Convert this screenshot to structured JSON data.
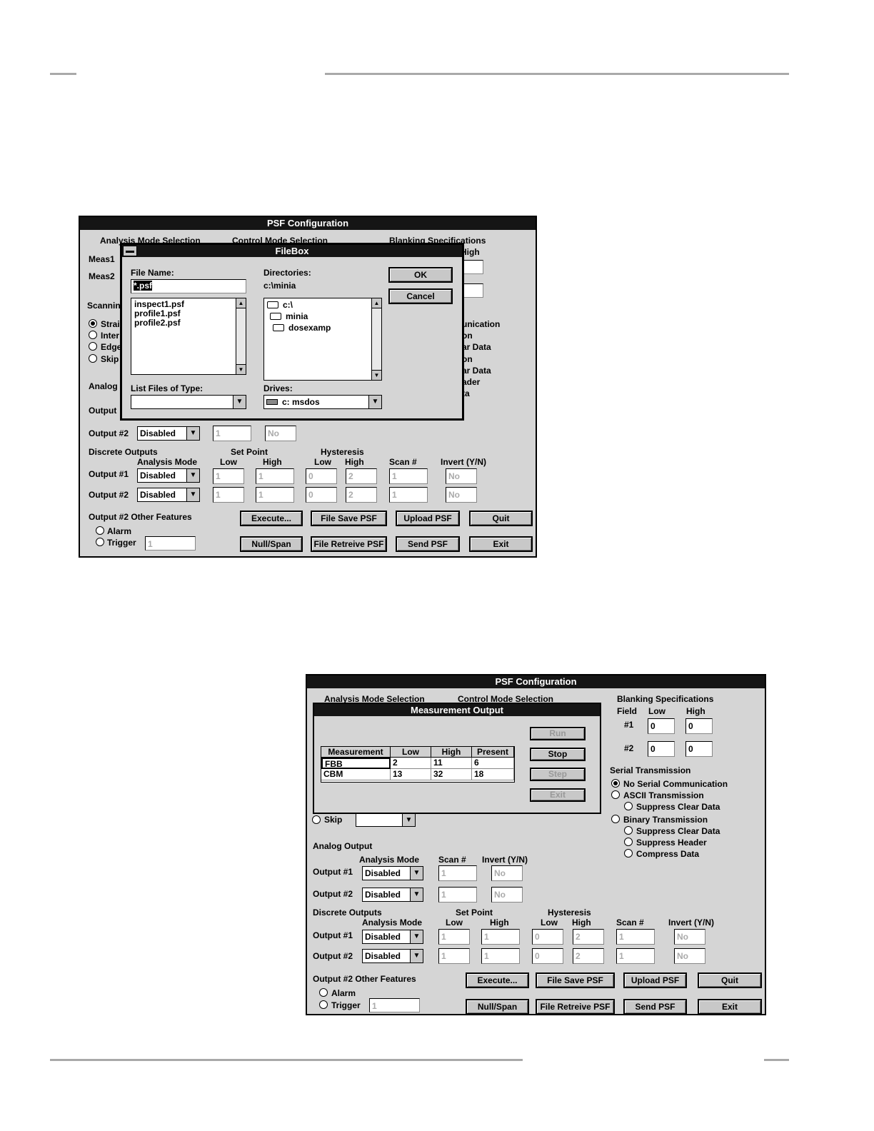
{
  "psf_title": "PSF Configuration",
  "top": {
    "analysis_mode_selection": "Analysis Mode Selection",
    "control_mode_selection": "Control Mode Selection",
    "blanking_specifications": "Blanking Specifications",
    "high_partial": "High",
    "meas1": "Meas1",
    "meas2": "Meas2",
    "scanning_partial": "Scannin",
    "scan_opts": [
      "Strai",
      "Inter",
      "Edge",
      "Skip"
    ],
    "right_fragments": [
      "unication",
      "on",
      "ar Data",
      "on",
      "ar Data",
      "ader",
      "ta"
    ],
    "analog_partial": "Analog",
    "output_partial": "Output",
    "filebox": {
      "title": "FileBox",
      "file_name_label": "File Name:",
      "file_name_value": "*.psf",
      "files": [
        "inspect1.psf",
        "profile1.psf",
        "profile2.psf"
      ],
      "directories_label": "Directories:",
      "current_dir": "c:\\minia",
      "dirs": [
        "c:\\",
        "minia",
        "dosexamp"
      ],
      "ok": "OK",
      "cancel": "Cancel",
      "list_files_label": "List Files of Type:",
      "drives_label": "Drives:",
      "drive_value": "c: msdos"
    },
    "out2_label": "Output #2",
    "out2_mode": "Disabled",
    "out2_scan": "1",
    "out2_invert": "No",
    "discrete": {
      "title": "Discrete Outputs",
      "analysis_mode": "Analysis Mode",
      "set_point": "Set Point",
      "hysteresis": "Hysteresis",
      "low": "Low",
      "high": "High",
      "scan": "Scan #",
      "invert": "Invert (Y/N)",
      "rows": [
        {
          "label": "Output #1",
          "mode": "Disabled",
          "sp_low": "1",
          "sp_high": "1",
          "hy_low": "0",
          "hy_high": "2",
          "scan": "1",
          "invert": "No"
        },
        {
          "label": "Output #2",
          "mode": "Disabled",
          "sp_low": "1",
          "sp_high": "1",
          "hy_low": "0",
          "hy_high": "2",
          "scan": "1",
          "invert": "No"
        }
      ]
    },
    "other_features": "Output #2 Other Features",
    "alarm": "Alarm",
    "trigger": "Trigger",
    "trigger_value": "1",
    "buttons": [
      "Execute...",
      "File Save PSF",
      "Upload PSF",
      "Quit",
      "Null/Span",
      "File Retreive PSF",
      "Send PSF",
      "Exit"
    ]
  },
  "bottom": {
    "analysis_mode_selection": "Analysis Mode Selection",
    "control_mode_selection": "Control Mode Selection",
    "blanking": {
      "title": "Blanking Specifications",
      "field": "Field",
      "low": "Low",
      "high": "High",
      "rows": [
        {
          "label": "#1",
          "low": "0",
          "high": "0"
        },
        {
          "label": "#2",
          "low": "0",
          "high": "0"
        }
      ]
    },
    "serial": {
      "title": "Serial Transmission",
      "options": [
        "No Serial Communication",
        "ASCII Transmission",
        "Suppress Clear Data",
        "Binary Transmission",
        "Suppress Clear Data",
        "Suppress Header",
        "Compress Data"
      ]
    },
    "skip": "Skip",
    "measurement": {
      "title": "Measurement Output",
      "buttons": [
        "Run",
        "Stop",
        "Step",
        "Exit"
      ],
      "columns": [
        "Measurement",
        "Low",
        "High",
        "Present"
      ],
      "rows": [
        [
          "FBB",
          "2",
          "11",
          "6"
        ],
        [
          "CBM",
          "13",
          "32",
          "18"
        ]
      ]
    },
    "analog": {
      "title": "Analog Output",
      "analysis_mode": "Analysis Mode",
      "scan": "Scan #",
      "invert": "Invert (Y/N)",
      "rows": [
        {
          "label": "Output #1",
          "mode": "Disabled",
          "scan": "1",
          "invert": "No"
        },
        {
          "label": "Output #2",
          "mode": "Disabled",
          "scan": "1",
          "invert": "No"
        }
      ]
    },
    "discrete": {
      "title": "Discrete Outputs",
      "analysis_mode": "Analysis Mode",
      "set_point": "Set Point",
      "hysteresis": "Hysteresis",
      "low": "Low",
      "high": "High",
      "scan": "Scan #",
      "invert": "Invert (Y/N)",
      "rows": [
        {
          "label": "Output #1",
          "mode": "Disabled",
          "sp_low": "1",
          "sp_high": "1",
          "hy_low": "0",
          "hy_high": "2",
          "scan": "1",
          "invert": "No"
        },
        {
          "label": "Output #2",
          "mode": "Disabled",
          "sp_low": "1",
          "sp_high": "1",
          "hy_low": "0",
          "hy_high": "2",
          "scan": "1",
          "invert": "No"
        }
      ]
    },
    "other_features": "Output #2 Other Features",
    "alarm": "Alarm",
    "trigger": "Trigger",
    "trigger_value": "1",
    "buttons": [
      "Execute...",
      "File Save PSF",
      "Upload PSF",
      "Quit",
      "Null/Span",
      "File Retreive PSF",
      "Send PSF",
      "Exit"
    ]
  }
}
